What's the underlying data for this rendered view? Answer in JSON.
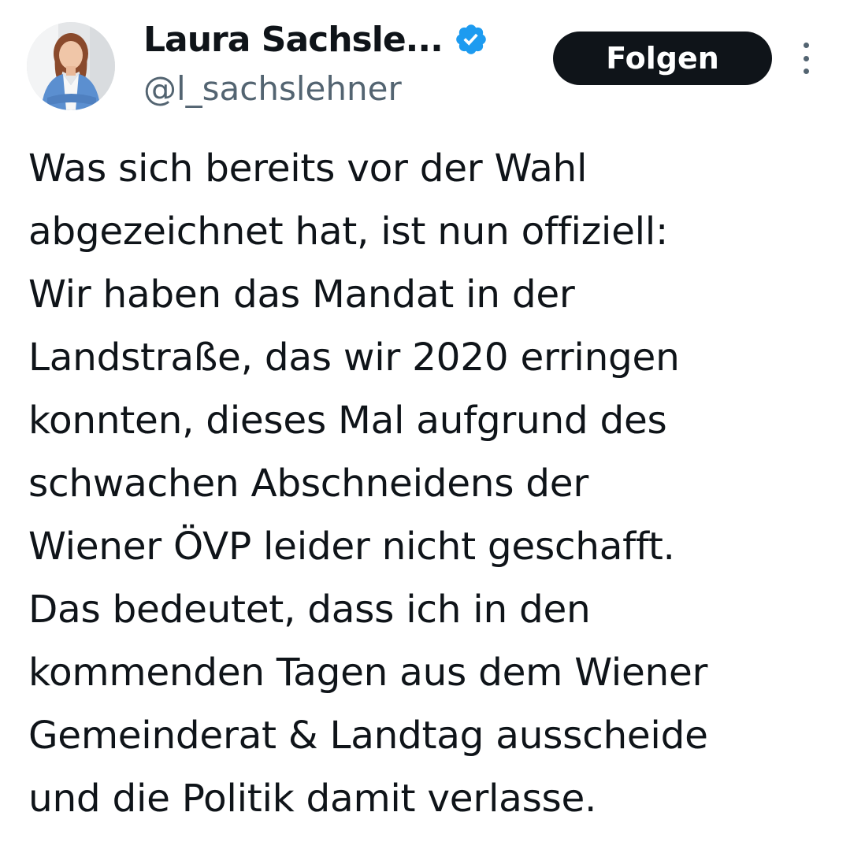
{
  "tweet": {
    "author": {
      "display_name": "Laura Sachsle...",
      "handle": "@l_sachslehner",
      "verified_icon": "verified-badge-icon",
      "avatar": "profile-photo"
    },
    "follow_label": "Folgen",
    "more_icon": "more-options-icon",
    "text_lines": [
      "Was sich bereits vor der Wahl",
      "abgezeichnet hat, ist nun offiziell:",
      "Wir haben das Mandat in der",
      "Landstraße, das wir 2020 erringen",
      "konnten, dieses Mal aufgrund des",
      "schwachen Abschneidens der",
      "Wiener ÖVP leider nicht geschafft.",
      "Das bedeutet, dass ich in den",
      "kommenden Tagen aus dem Wiener",
      "Gemeinderat & Landtag ausscheide",
      "und die Politik damit verlasse."
    ]
  },
  "colors": {
    "text": "#0f1419",
    "secondary_text": "#536471",
    "verified_blue": "#1d9bf0",
    "button_bg": "#0f1419",
    "button_text": "#ffffff",
    "background": "#ffffff"
  }
}
